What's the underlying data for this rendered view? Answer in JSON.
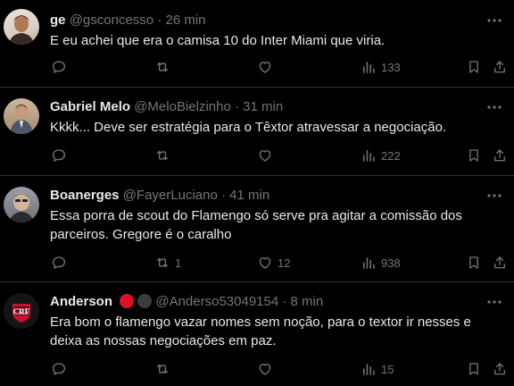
{
  "tweets": [
    {
      "name": "ge",
      "handle": "@gsconcesso",
      "dot": "·",
      "time": "26 min",
      "text": "E eu achei que era o camisa 10 do Inter Miami que viria.",
      "replies": "",
      "retweets": "",
      "likes": "",
      "views": "133"
    },
    {
      "name": "Gabriel Melo",
      "handle": "@MeloBielzinho",
      "dot": "·",
      "time": "31 min",
      "text": "Kkkk... Deve ser estratégia para o Têxtor atravessar a negociação.",
      "replies": "",
      "retweets": "",
      "likes": "",
      "views": "222"
    },
    {
      "name": "Boanerges",
      "handle": "@FayerLuciano",
      "dot": "·",
      "time": "41 min",
      "text": "Essa porra de scout do Flamengo só serve pra agitar a comissão dos parceiros. Gregore é o caralho",
      "replies": "",
      "retweets": "1",
      "likes": "12",
      "views": "938"
    },
    {
      "name": "Anderson",
      "handle": "@Anderso53049154",
      "dot": "·",
      "time": "8 min",
      "text": "Era bom o flamengo vazar nomes sem noção, para o textor ir nesses e deixa as nossas negociações em paz.",
      "replies": "",
      "retweets": "",
      "likes": "",
      "views": "15",
      "badge_colors": [
        "#e0102a",
        "#3a3d42"
      ]
    }
  ],
  "colors": {
    "muted": "#71767b",
    "text": "#e7e9ea",
    "divider": "#2f3336"
  }
}
